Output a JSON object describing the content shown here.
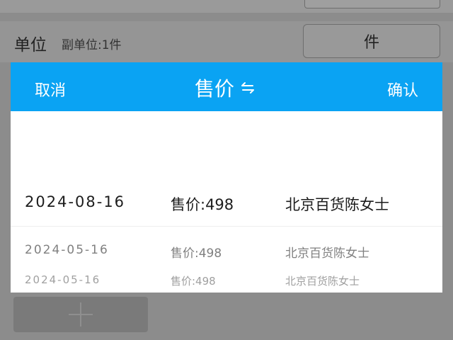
{
  "background": {
    "unit_label": "单位",
    "sub_unit_label": "副单位:1件",
    "unit_value": "件",
    "add_icon": "plus-icon"
  },
  "dialog": {
    "cancel_label": "取消",
    "title": "售价",
    "title_icon": "swap-arrows-icon",
    "confirm_label": "确认",
    "header_color": "#0aa3f3"
  },
  "picker": {
    "rows": [
      {
        "date": "2024-08-16",
        "price": "售价:498",
        "customer": "北京百货陈女士",
        "selected": true
      },
      {
        "date": "2024-05-16",
        "price": "售价:498",
        "customer": "北京百货陈女士",
        "selected": false
      },
      {
        "date": "2024-05-16",
        "price": "售价:498",
        "customer": "北京百货陈女士",
        "selected": false
      }
    ]
  }
}
